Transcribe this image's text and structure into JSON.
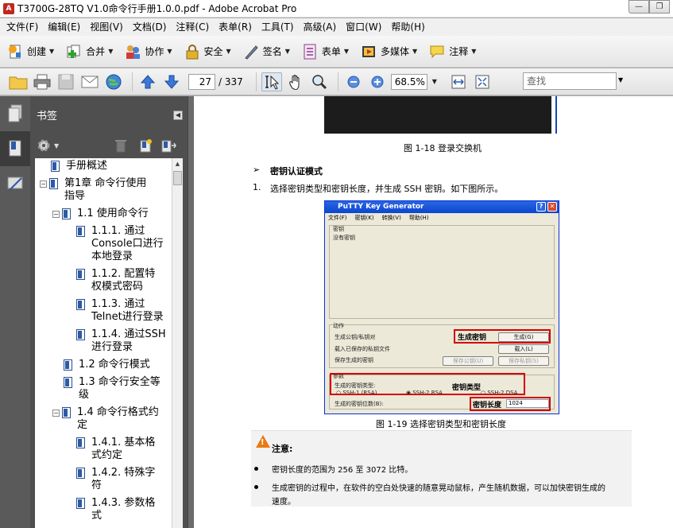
{
  "window": {
    "title": "T3700G-28TQ V1.0命令行手册1.0.0.pdf - Adobe Acrobat Pro",
    "app_icon_label": "A"
  },
  "menu": [
    "文件(F)",
    "编辑(E)",
    "视图(V)",
    "文档(D)",
    "注释(C)",
    "表单(R)",
    "工具(T)",
    "高级(A)",
    "窗口(W)",
    "帮助(H)"
  ],
  "tasks": [
    {
      "label": "创建",
      "icon": "create-pdf-icon"
    },
    {
      "label": "合并",
      "icon": "combine-icon"
    },
    {
      "label": "协作",
      "icon": "collaborate-icon"
    },
    {
      "label": "安全",
      "icon": "lock-icon"
    },
    {
      "label": "签名",
      "icon": "pen-icon"
    },
    {
      "label": "表单",
      "icon": "form-icon"
    },
    {
      "label": "多媒体",
      "icon": "multimedia-icon"
    },
    {
      "label": "注释",
      "icon": "comment-icon"
    }
  ],
  "nav": {
    "current_page": "27",
    "total_pages": "/ 337",
    "zoom": "68.5%",
    "search_placeholder": "查找"
  },
  "bookmarks_panel": {
    "title": "书签",
    "items": [
      {
        "text": "手册概述",
        "expander": ""
      },
      {
        "text": "第1章 命令行使用\n指导",
        "expander": "−"
      },
      {
        "text": "1.1 使用命令行",
        "expander": "−"
      },
      {
        "text": "1.1.1. 通过\nConsole口进行\n本地登录",
        "expander": ""
      },
      {
        "text": "1.1.2. 配置特\n权模式密码",
        "expander": ""
      },
      {
        "text": "1.1.3. 通过\nTelnet进行登录",
        "expander": ""
      },
      {
        "text": "1.1.4. 通过SSH\n进行登录",
        "expander": ""
      },
      {
        "text": "1.2 命令行模式",
        "expander": ""
      },
      {
        "text": "1.3 命令行安全等\n级",
        "expander": ""
      },
      {
        "text": "1.4 命令行格式约\n定",
        "expander": "−"
      },
      {
        "text": "1.4.1. 基本格\n式约定",
        "expander": ""
      },
      {
        "text": "1.4.2. 特殊字\n符",
        "expander": ""
      },
      {
        "text": "1.4.3. 参数格\n式",
        "expander": ""
      }
    ]
  },
  "document": {
    "fig18_caption": "图 1-18 登录交换机",
    "section_arrow": "➢",
    "section_title": "密钥认证模式",
    "step_num": "1.",
    "step_text": "选择密钥类型和密钥长度，并生成 SSH 密钥。如下图所示。",
    "fig19_caption": "图 1-19 选择密钥类型和密钥长度",
    "putty": {
      "title": "PuTTY Key Generator",
      "menu": [
        "文件(F)",
        "密钥(K)",
        "转换(V)",
        "帮助(H)"
      ],
      "key_group": "密钥",
      "no_key": "没有密钥",
      "actions_group": "动作",
      "gen_label": "生成公钥/私钥对",
      "load_label": "载入已保存的私钥文件",
      "save_label": "保存生成的密钥",
      "gen_button": "生成(G)",
      "load_button": "载入(L)",
      "save_pub_button": "保存公钥(U)",
      "save_priv_button": "保存私钥(S)",
      "params_group": "参数",
      "key_type_label": "生成的密钥类型:",
      "ssh1_rsa": "SSH-1 (RSA)",
      "ssh2_rsa": "SSH-2 RSA",
      "ssh2_dsa": "SSH-2 DSA",
      "bits_label": "生成的密钥位数(B):",
      "bits_value": "1024",
      "annot_gen": "生成密钥",
      "annot_type": "密钥类型",
      "annot_len": "密钥长度"
    },
    "note": {
      "title": "注意:",
      "bullets": [
        "密钥长度的范围为 256 至 3072 比特。",
        "生成密钥的过程中，在软件的空白处快速的随意晃动鼠标，产生随机数据，可以加快密钥生成的",
        "速度。"
      ]
    }
  }
}
